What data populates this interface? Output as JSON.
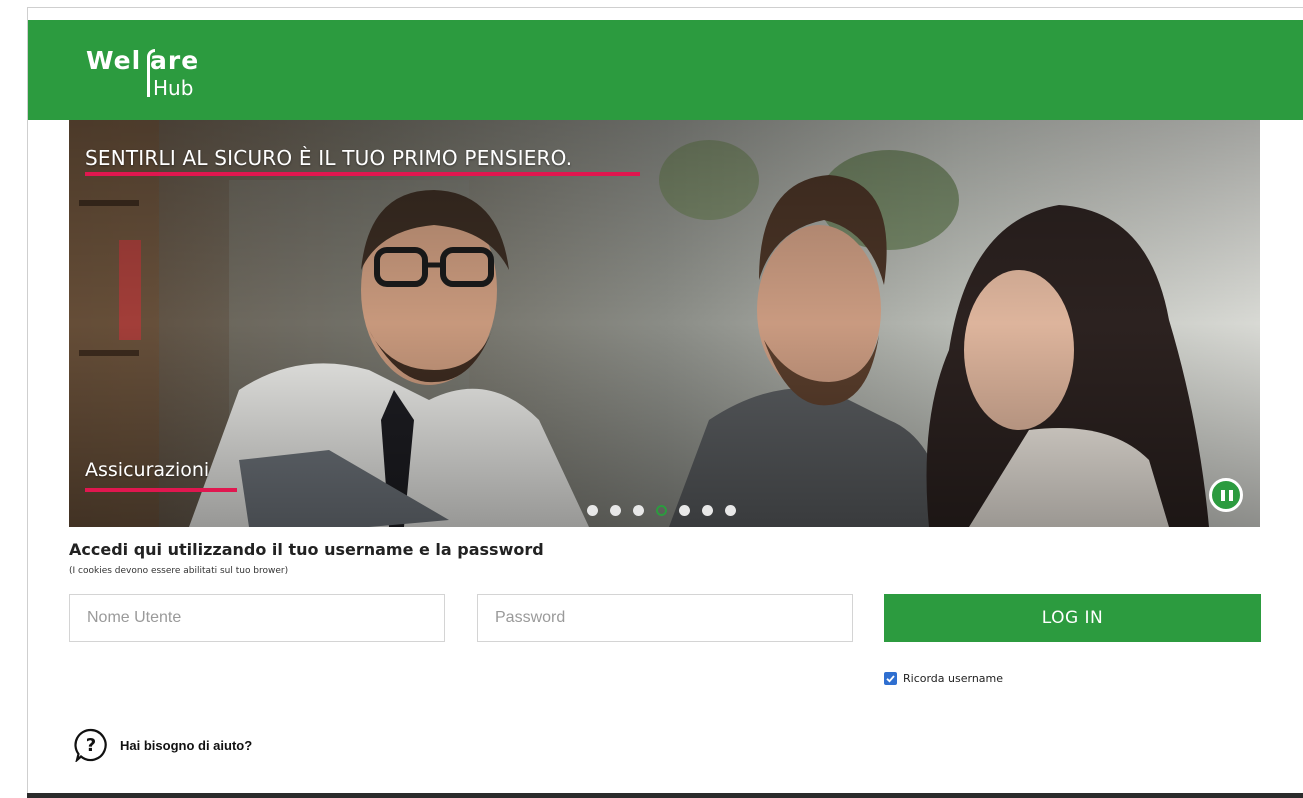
{
  "brand": {
    "logo_part1": "Wel",
    "logo_part2": "are",
    "logo_part3": "Hub",
    "primary_color": "#2c9b3f",
    "accent_color": "#e0174f"
  },
  "hero": {
    "headline": "SENTIRLI AL SICURO È IL TUO PRIMO PENSIERO.",
    "category": "Assicurazioni",
    "slide_count": 7,
    "active_slide": 4,
    "pause_icon": "pause-icon"
  },
  "login": {
    "title": "Accedi qui utilizzando il tuo username e la password",
    "note": "(I cookies devono essere abilitati sul tuo brower)",
    "username_placeholder": "Nome Utente",
    "password_placeholder": "Password",
    "submit_label": "LOG IN",
    "remember_label": "Ricorda username",
    "remember_checked": true
  },
  "help": {
    "icon": "question-icon",
    "label": "Hai bisogno di aiuto?"
  }
}
